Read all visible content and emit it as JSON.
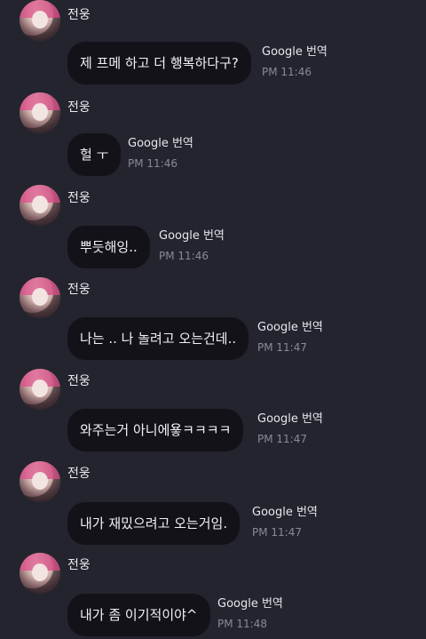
{
  "messages": [
    {
      "sender": "전웅",
      "text": "제 프메 하고 더 행복하다구?",
      "translate": "Google 번역",
      "time": "PM 11:46"
    },
    {
      "sender": "전웅",
      "text": "헐 ㅜ",
      "translate": "Google 번역",
      "time": "PM 11:46"
    },
    {
      "sender": "전웅",
      "text": "뿌듯해잉..",
      "translate": "Google 번역",
      "time": "PM 11:46"
    },
    {
      "sender": "전웅",
      "text": "나는 .. 나 놀려고 오는건데..",
      "translate": "Google 번역",
      "time": "PM 11:47"
    },
    {
      "sender": "전웅",
      "text": "와주는거 아니에욯ㅋㅋㅋㅋ",
      "translate": "Google 번역",
      "time": "PM 11:47"
    },
    {
      "sender": "전웅",
      "text": "내가 재밌으려고 오는거임.",
      "translate": "Google 번역",
      "time": "PM 11:47"
    },
    {
      "sender": "전웅",
      "text": "내가 좀 이기적이야^",
      "translate": "Google 번역",
      "time": "PM 11:48"
    }
  ]
}
